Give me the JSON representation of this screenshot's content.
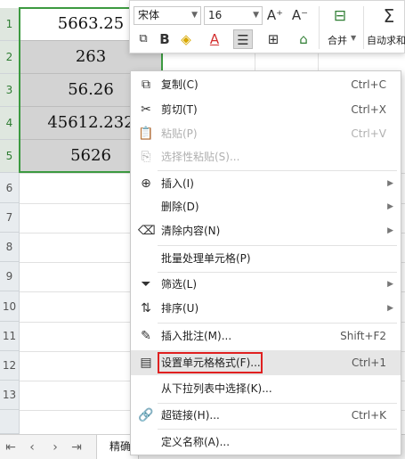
{
  "rows": [
    "1",
    "2",
    "3",
    "4",
    "5",
    "6",
    "7",
    "8",
    "9",
    "10",
    "11",
    "12",
    "13"
  ],
  "cells": [
    "5663.25",
    "263",
    "56.26",
    "45612.232",
    "5626"
  ],
  "toolbar": {
    "font_name": "宋体",
    "font_size": "16",
    "grow_font": "A⁺",
    "shrink_font": "A⁻",
    "bold": "B",
    "merge_label": "合并",
    "autosum_label": "自动求和"
  },
  "menu": {
    "copy": {
      "label": "复制(C)",
      "shortcut": "Ctrl+C"
    },
    "cut": {
      "label": "剪切(T)",
      "shortcut": "Ctrl+X"
    },
    "paste": {
      "label": "粘贴(P)",
      "shortcut": "Ctrl+V"
    },
    "paste_special": {
      "label": "选择性粘贴(S)..."
    },
    "insert": {
      "label": "插入(I)"
    },
    "delete": {
      "label": "删除(D)"
    },
    "clear": {
      "label": "清除内容(N)"
    },
    "batch": {
      "label": "批量处理单元格(P)"
    },
    "filter": {
      "label": "筛选(L)"
    },
    "sort": {
      "label": "排序(U)"
    },
    "insert_comment": {
      "label": "插入批注(M)...",
      "shortcut": "Shift+F2"
    },
    "format_cells": {
      "label": "设置单元格格式(F)...",
      "shortcut": "Ctrl+1"
    },
    "pick_list": {
      "label": "从下拉列表中选择(K)..."
    },
    "hyperlink": {
      "label": "超链接(H)...",
      "shortcut": "Ctrl+K"
    },
    "define_name": {
      "label": "定义名称(A)..."
    }
  },
  "sheet_tab": "精确",
  "colors": {
    "selection": "#3c9a40",
    "highlight": "#e02020",
    "selected_fill": "#d3d3d3"
  }
}
